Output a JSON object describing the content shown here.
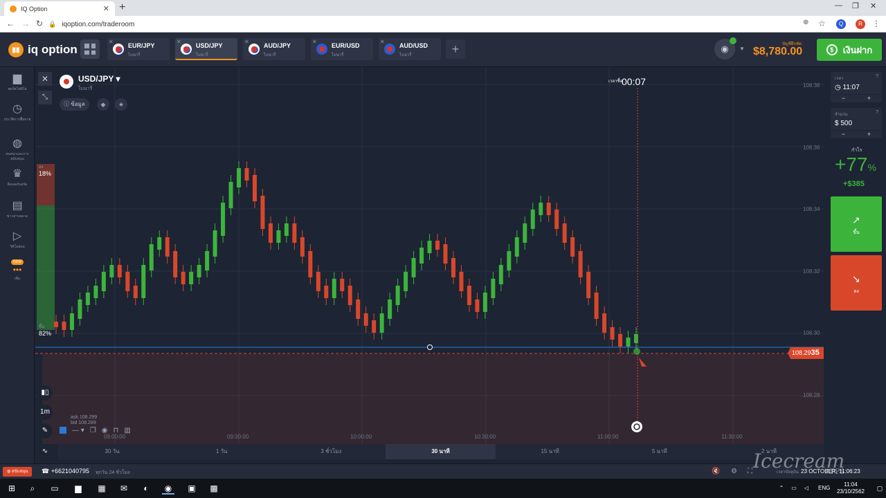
{
  "browser": {
    "tab_title": "IQ Option",
    "url": "iqoption.com/traderoom"
  },
  "header": {
    "logo": "iq option",
    "assets": [
      {
        "name": "EUR/JPY",
        "sub": "ไบนารี่"
      },
      {
        "name": "USD/JPY",
        "sub": "ไบนารี่"
      },
      {
        "name": "AUD/JPY",
        "sub": "ไบนารี่"
      },
      {
        "name": "EUR/USD",
        "sub": "ไบนารี่"
      },
      {
        "name": "AUD/USD",
        "sub": "ไบนารี่"
      }
    ],
    "balance_label": "บัญชีฝึกหัด",
    "balance": "$8,780.00",
    "deposit": "เงินฝาก"
  },
  "sidebar": [
    {
      "icon": "briefcase-icon",
      "label": "พอร์ตโฟลิโอ"
    },
    {
      "icon": "history-icon",
      "label": "ประวัติการซื้อขาย"
    },
    {
      "icon": "chat-icon",
      "label": "สนทนาและการสนับสนุน"
    },
    {
      "icon": "trophy-icon",
      "label": "ลีดเดอร์บอร์ด"
    },
    {
      "icon": "news-icon",
      "label": "ข่าวสารตลาด"
    },
    {
      "icon": "video-icon",
      "label": "วิดีโอสอน"
    },
    {
      "icon": "more-icon",
      "label": "เพิ่ม",
      "badge": "NEW"
    }
  ],
  "chart": {
    "pair": "USD/JPY",
    "pair_sub": "ไบนารี่",
    "info_label": "ข้อมูล",
    "sentiment_down_label": "ลง",
    "sentiment_down": "18%",
    "sentiment_up_label": "ขึ้น",
    "sentiment_up": "82%",
    "expiry_label": "เวลาซื้อ",
    "countdown": "00:07",
    "price_tag_main": "108.29",
    "price_tag_last": "35",
    "yticks": [
      "108.38",
      "108.36",
      "108.34",
      "108.32",
      "108.30",
      "108.28"
    ],
    "xticks": [
      "09:00:00",
      "09:30:00",
      "10:00:00",
      "10:30:00",
      "11:00:00",
      "11:30:00"
    ],
    "interval": "1m",
    "ask": "ask 108.299",
    "bid": "bid 108.289",
    "periods": [
      "30 วัน",
      "1 วัน",
      "3 ชั่วโมง",
      "30 นาที",
      "15 นาที",
      "5 นาที",
      "2 นาที"
    ],
    "active_period": "30 นาที"
  },
  "right_panel": {
    "time_label": "เวลา",
    "time": "11:07",
    "amount_label": "จำนวน",
    "amount": "$ 500",
    "profit_label": "กำไร",
    "profit_pct": "+77",
    "profit_unit": "%",
    "profit_amount": "+$385",
    "call": "ขึ้น",
    "put": "ลง"
  },
  "statusbar": {
    "support": "สนับสนุน",
    "phone": "+6621040795",
    "hours": "ทุกวัน 24 ชั่วโมง",
    "date_label": "เวลาปัจจุบัน:",
    "datetime": "23 OCTOBER, 11:06:23",
    "watermark": "Icecream",
    "watermark_sub": "APPS"
  },
  "taskbar": {
    "lang": "ENG",
    "time": "11:04",
    "date": "23/10/2562"
  },
  "colors": {
    "up": "#3cb43c",
    "down": "#d9472b",
    "accent": "#f7931e",
    "bg": "#1d2433"
  }
}
